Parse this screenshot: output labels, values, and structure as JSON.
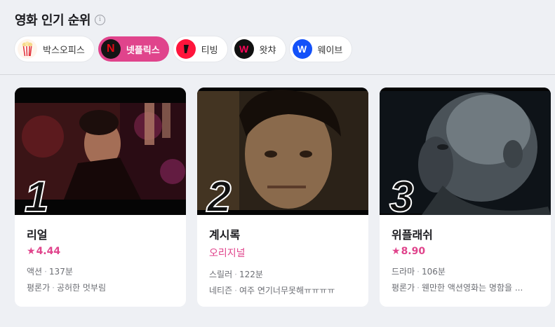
{
  "header": {
    "title": "영화 인기 순위",
    "info_glyph": "i"
  },
  "tabs": [
    {
      "label": "박스오피스",
      "icon": "popcorn-icon",
      "active": false
    },
    {
      "label": "넷플릭스",
      "icon": "netflix-icon",
      "active": true,
      "glyph": "N"
    },
    {
      "label": "티빙",
      "icon": "tving-icon",
      "active": false
    },
    {
      "label": "왓챠",
      "icon": "watcha-icon",
      "active": false,
      "glyph": "W"
    },
    {
      "label": "웨이브",
      "icon": "wavve-icon",
      "active": false,
      "glyph": "W"
    }
  ],
  "colors": {
    "accent": "#e0448c",
    "background": "#eef0f4"
  },
  "movies": [
    {
      "rank": "1",
      "title": "리얼",
      "rating_star": "★",
      "rating": "4.44",
      "genre": "액션",
      "duration": "137분",
      "review_source": "평론가",
      "review": "공허한 멋부림"
    },
    {
      "rank": "2",
      "title": "계시록",
      "badge": "오리지널",
      "genre": "스릴러",
      "duration": "122분",
      "review_source": "네티즌",
      "review": "여주 연기너무못해ㅠㅠㅠㅠ"
    },
    {
      "rank": "3",
      "title": "위플래쉬",
      "rating_star": "★",
      "rating": "8.90",
      "genre": "드라마",
      "duration": "106분",
      "review_source": "평론가",
      "review": "웬만한 액션영화는 명함을 ..."
    }
  ]
}
